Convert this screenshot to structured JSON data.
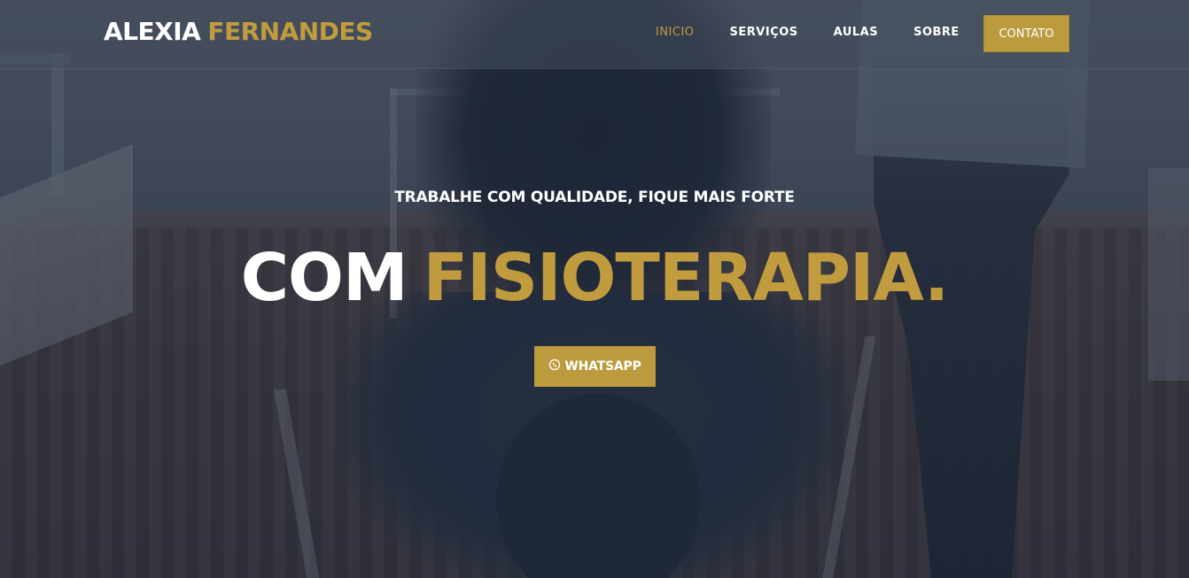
{
  "brand": {
    "first": "ALEXIA",
    "last": "FERNANDES"
  },
  "nav": {
    "items": [
      {
        "label": "INICIO",
        "active": true
      },
      {
        "label": "SERVIÇOS",
        "active": false
      },
      {
        "label": "AULAS",
        "active": false
      },
      {
        "label": "SOBRE",
        "active": false
      }
    ],
    "contact_label": "CONTATO"
  },
  "hero": {
    "tagline": "TRABALHE COM QUALIDADE, FIQUE MAIS FORTE",
    "headline_white": "COM",
    "headline_gold": "FISIOTERAPIA.",
    "cta_label": "WHATSAPP",
    "cta_icon": "whatsapp-icon"
  },
  "colors": {
    "accent_gold": "#c09c3e",
    "button_gold": "#bb9b3d",
    "text_white": "#ffffff",
    "navbar_overlay": "#464e5c"
  }
}
